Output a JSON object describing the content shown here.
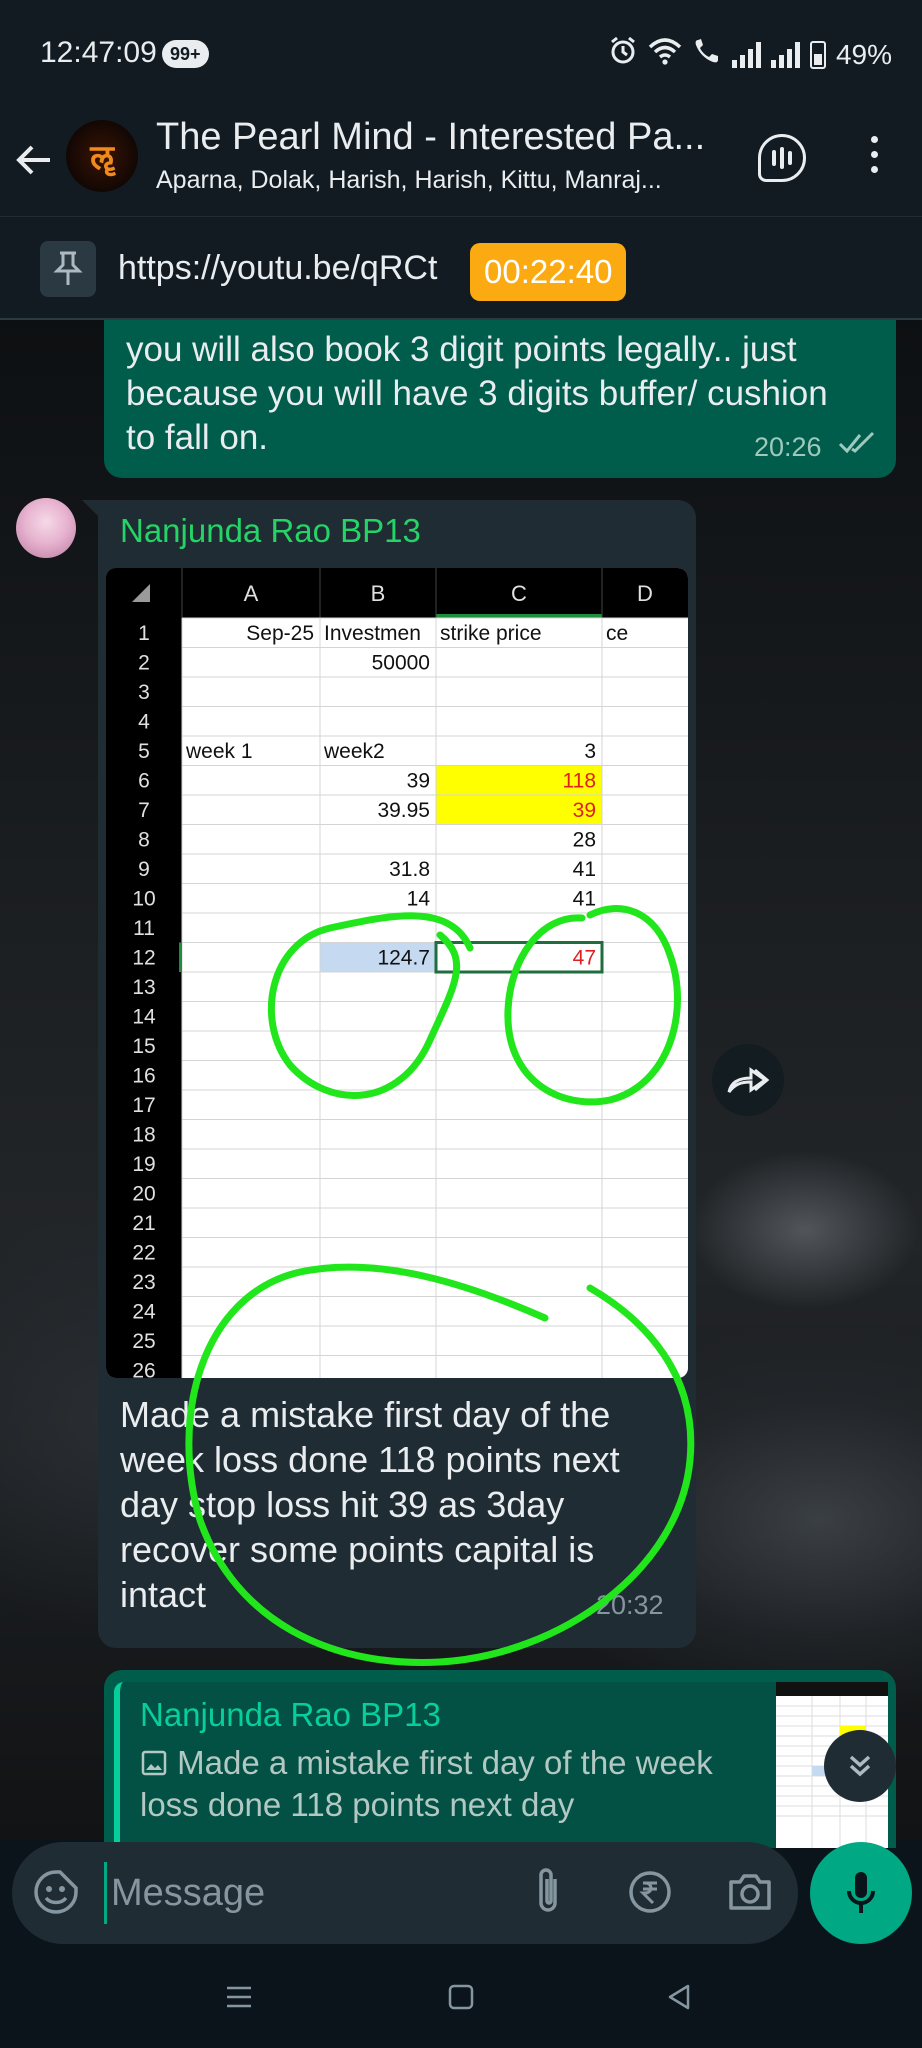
{
  "status_bar": {
    "time": "12:47:09",
    "notification_badge": "99+",
    "battery": "49%"
  },
  "header": {
    "back_icon": "arrow-left-icon",
    "avatar_glyph": "ॡ",
    "title": "The Pearl Mind - Interested Pa...",
    "members": "Aparna, Dolak, Harish, Harish, Kittu, Manraj..."
  },
  "pinned": {
    "link": "https://youtu.be/qRCt",
    "timer": "00:22:40"
  },
  "messages": {
    "outgoing_1": {
      "text": "you will also book 3 digit points legally.. just because you will have 3 digits buffer/ cushion to fall on.",
      "time": "20:26"
    },
    "incoming_1": {
      "sender": "Nanjunda Rao BP13",
      "text": "Made a mistake first day of the week  loss done 118 points next day stop loss hit 39 as 3day recover  some points capital  is intact",
      "time": "20:32",
      "image": {
        "col_headers": [
          "A",
          "B",
          "C",
          "D"
        ],
        "row_numbers": [
          "1",
          "2",
          "3",
          "4",
          "5",
          "6",
          "7",
          "8",
          "9",
          "10",
          "11",
          "12",
          "13",
          "14",
          "15",
          "16",
          "17",
          "18",
          "19",
          "20",
          "21",
          "22",
          "23",
          "24",
          "25",
          "26"
        ],
        "cells": [
          {
            "row": 1,
            "col": "A",
            "text": "Sep-25",
            "align": "right"
          },
          {
            "row": 1,
            "col": "B",
            "text": "Investmen",
            "align": "left"
          },
          {
            "row": 1,
            "col": "C",
            "text": "strike price",
            "align": "left"
          },
          {
            "row": 1,
            "col": "D",
            "text": "ce",
            "align": "left"
          },
          {
            "row": 2,
            "col": "B",
            "text": "50000",
            "align": "right"
          },
          {
            "row": 5,
            "col": "A",
            "text": "week 1",
            "align": "left"
          },
          {
            "row": 5,
            "col": "B",
            "text": "week2",
            "align": "left"
          },
          {
            "row": 5,
            "col": "C",
            "text": "3",
            "align": "right"
          },
          {
            "row": 6,
            "col": "B",
            "text": "39",
            "align": "right"
          },
          {
            "row": 6,
            "col": "C",
            "text": "118",
            "align": "right",
            "color": "#e02020",
            "fill": "#ffff00"
          },
          {
            "row": 7,
            "col": "B",
            "text": "39.95",
            "align": "right"
          },
          {
            "row": 7,
            "col": "C",
            "text": "39",
            "align": "right",
            "color": "#e02020",
            "fill": "#ffff00"
          },
          {
            "row": 8,
            "col": "C",
            "text": "28",
            "align": "right"
          },
          {
            "row": 9,
            "col": "B",
            "text": "31.8",
            "align": "right"
          },
          {
            "row": 9,
            "col": "C",
            "text": "41",
            "align": "right"
          },
          {
            "row": 10,
            "col": "B",
            "text": "14",
            "align": "right"
          },
          {
            "row": 10,
            "col": "C",
            "text": "41",
            "align": "right"
          },
          {
            "row": 12,
            "col": "B",
            "text": "124.7",
            "align": "right",
            "fill": "#c5d9f1"
          },
          {
            "row": 12,
            "col": "C",
            "text": "47",
            "align": "right",
            "color": "#e02020",
            "selected": true
          }
        ]
      }
    },
    "reply_preview": {
      "sender": "Nanjunda Rao BP13",
      "text": "Made a mistake first day of the week  loss done 118 points next day"
    }
  },
  "composer": {
    "placeholder": "Message",
    "icons": [
      "emoji-sticker-icon",
      "attach-icon",
      "rupee-payment-icon",
      "camera-icon",
      "mic-icon"
    ]
  },
  "colors": {
    "annotation": "#22e61c",
    "accent": "#00a884",
    "outgoing_bubble": "#005c4b",
    "incoming_bubble": "#202c33",
    "timer_badge": "#fbaa12"
  }
}
